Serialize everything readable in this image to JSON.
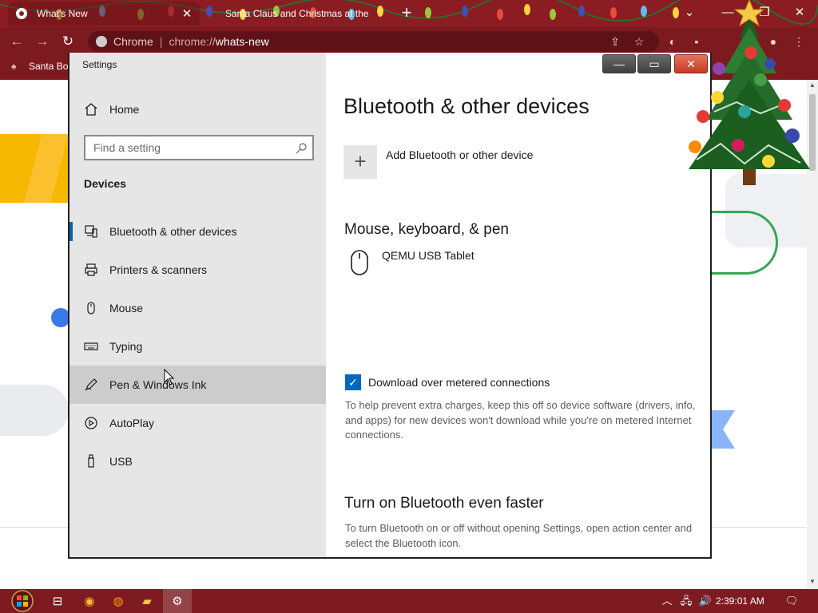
{
  "browser": {
    "tabs": [
      {
        "title": "What's New",
        "active": true
      },
      {
        "title": "Santa Claus and Christmas at the",
        "active": false
      }
    ],
    "new_tab_glyph": "+",
    "tab_close_glyph": "✕",
    "window_controls": {
      "dropdown": "⌄",
      "minimize": "—",
      "maximize": "❐",
      "close": "✕"
    },
    "omnibox": {
      "site": "Chrome",
      "separator": "|",
      "scheme": "chrome://",
      "host": "whats-new"
    },
    "bookmarks": [
      {
        "label": "Santa Bo"
      }
    ],
    "theme_color": "#8a1c22"
  },
  "settings": {
    "window_title": "Settings",
    "caption": {
      "minimize": "—",
      "maximize": "▭",
      "close": "✕"
    },
    "sidebar": {
      "home_label": "Home",
      "search_placeholder": "Find a setting",
      "group_title": "Devices",
      "items": [
        {
          "label": "Bluetooth & other devices",
          "icon": "bluetooth-devices-icon",
          "selected": true
        },
        {
          "label": "Printers & scanners",
          "icon": "printer-icon"
        },
        {
          "label": "Mouse",
          "icon": "mouse-icon"
        },
        {
          "label": "Typing",
          "icon": "keyboard-icon"
        },
        {
          "label": "Pen & Windows Ink",
          "icon": "pen-icon",
          "hovered": true
        },
        {
          "label": "AutoPlay",
          "icon": "autoplay-icon"
        },
        {
          "label": "USB",
          "icon": "usb-icon"
        }
      ]
    },
    "content": {
      "title": "Bluetooth & other devices",
      "add_device_label": "Add Bluetooth or other device",
      "add_glyph": "+",
      "section_input": "Mouse, keyboard, & pen",
      "device_name": "QEMU USB Tablet",
      "metered_checkbox_label": "Download over metered connections",
      "metered_checked": true,
      "check_glyph": "✓",
      "metered_help": "To help prevent extra charges, keep this off so device software (drivers, info, and apps) for new devices won't download while you're on metered Internet connections.",
      "faster_title": "Turn on Bluetooth even faster",
      "faster_help": "To turn Bluetooth on or off without opening Settings, open action center and select the Bluetooth icon."
    },
    "accent_color": "#0067c0"
  },
  "taskbar": {
    "apps": [
      {
        "name": "task-view",
        "glyph": "⊟"
      },
      {
        "name": "chrome",
        "glyph": "◉"
      },
      {
        "name": "firefox",
        "glyph": "◍"
      },
      {
        "name": "file-explorer",
        "glyph": "▰"
      },
      {
        "name": "settings",
        "glyph": "⚙",
        "active": true
      }
    ],
    "tray": {
      "chevron": "︿",
      "network": "🖧",
      "volume": "🔊",
      "notifications": "🗨"
    },
    "clock": "2:39:01 AM"
  }
}
